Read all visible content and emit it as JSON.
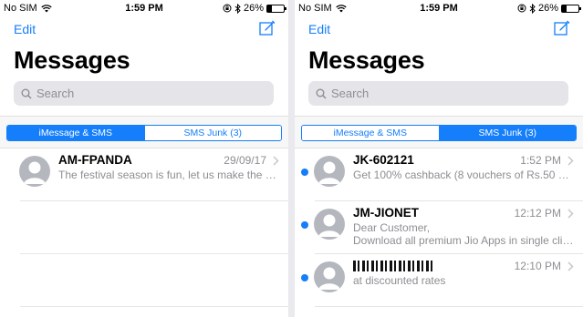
{
  "status": {
    "carrier": "No SIM",
    "time": "1:59 PM",
    "battery": "26%",
    "battery_level": 0.26
  },
  "nav": {
    "edit_label": "Edit",
    "title": "Messages",
    "search_placeholder": "Search"
  },
  "left": {
    "tabs": [
      {
        "label": "iMessage & SMS",
        "active": true
      },
      {
        "label": "SMS Junk (3)",
        "active": false
      }
    ],
    "threads": [
      {
        "sender": "AM-FPANDA",
        "date": "29/09/17",
        "preview": "The festival season is fun, let us make the m...",
        "unread": false
      }
    ]
  },
  "right": {
    "tabs": [
      {
        "label": "iMessage & SMS",
        "active": false
      },
      {
        "label": "SMS Junk (3)",
        "active": true
      }
    ],
    "threads": [
      {
        "sender": "JK-602121",
        "date": "1:52 PM",
        "preview": "Get 100% cashback (8 vouchers of Rs.50 ea...",
        "unread": true
      },
      {
        "sender": "JM-JIONET",
        "date": "12:12 PM",
        "preview": "Dear Customer,",
        "preview2": "Download all premium Jio Apps in single clic...",
        "unread": true
      },
      {
        "sender": "",
        "date": "12:10 PM",
        "preview": "at discounted rates",
        "unread": true
      }
    ]
  },
  "colors": {
    "accent": "#147efb",
    "secondary_text": "#8e8e93",
    "avatar": "#b4b7be"
  },
  "icons": [
    "wifi-icon",
    "lock-rotation-icon",
    "bluetooth-icon",
    "battery-icon",
    "compose-icon",
    "search-icon",
    "chevron-right-icon",
    "contact-avatar-icon"
  ]
}
